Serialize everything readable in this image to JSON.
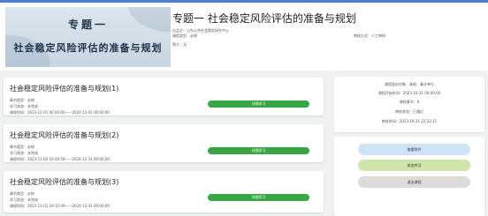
{
  "course": {
    "cover_title_line1": "专题一",
    "cover_title_line2": "社会稳定风险评估的准备与规划",
    "title": "专题一 社会稳定风险评估的准备与规划",
    "provider": "出品方：山东公共社会稳定研究中心",
    "category": "课程类型：必修",
    "review_method": "审核方式：人工审核",
    "intro": "简介：无"
  },
  "lessons": [
    {
      "title": "社会稳定风险评估的准备与规划(1)",
      "type": "章节类型：必修",
      "status": "学习状态：未完成",
      "time": "课程时间：2023-11-01 00:00:00——2024-12-01 00:00:00",
      "button": "详细学习"
    },
    {
      "title": "社会稳定风险评估的准备与规划(2)",
      "type": "章节类型：必修",
      "status": "学习状态：未完成",
      "time": "课程时间：2023-11-02 19:26:58——2024-12-31 00:00:00",
      "button": "详细学习"
    },
    {
      "title": "社会稳定风险评估的准备与规划(3)",
      "type": "章节类型：必修",
      "status": "学习状态：未完成",
      "time": "课程时间：2023-11-01 19:35:49——2024-12-31 00:00:00",
      "button": "详细学习"
    }
  ],
  "info": {
    "audience": "课程面向对象：高校、事业单位",
    "start_time": "课程开始时间：2023-10-31 00:00:00",
    "chapters": "课程章节：6",
    "review_status": "审核状态：已通过",
    "review_time": "审核时间：2023-10-31 22:22:11"
  },
  "actions": {
    "attachment": "查看附件",
    "exam": "参加考试",
    "withdraw": "退出课程"
  },
  "colors": {
    "accent": "#4a7fd6",
    "study_button": "#3aa545",
    "attachment_button": "#cfe3f7",
    "exam_button": "#cfe5ab",
    "withdraw_button": "#dcdcdc"
  }
}
